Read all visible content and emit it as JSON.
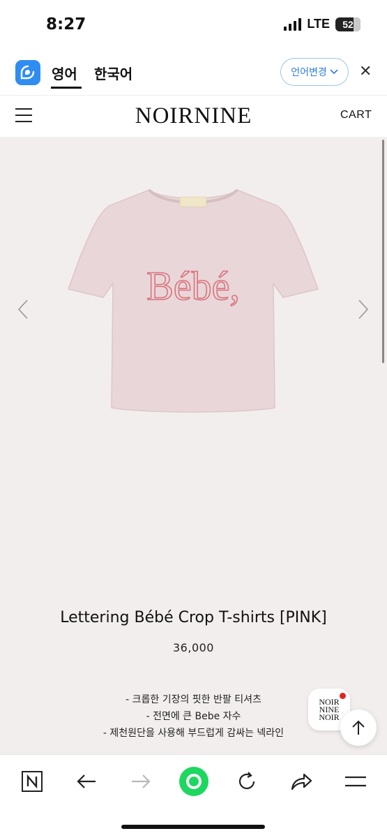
{
  "status_bar": {
    "time": "8:27",
    "network": "LTE",
    "battery": "52"
  },
  "translate_bar": {
    "tab_active": "영어",
    "tab_second": "한국어",
    "language_change_label": "언어변경",
    "close_symbol": "✕"
  },
  "site_header": {
    "logo": "NOIRNINE",
    "cart_label": "CART"
  },
  "product": {
    "shirt_print": "Bébé,",
    "title": "Lettering Bébé Crop T-shirts [PINK]",
    "price": "36,000",
    "description": [
      "- 크롭한 기장의 핏한 반팔 티셔츠",
      "- 전면에 큰 Bebe 자수",
      "- 제천원단을 사용해 부드럽게 감싸는 넥라인"
    ]
  },
  "brand_badge": {
    "lines": [
      "NOIR",
      "NINE",
      "NOIR"
    ]
  },
  "colors": {
    "accent_blue": "#2f8df2",
    "product_bg": "#f3eeee",
    "shirt_pink": "#e9d6d8",
    "embroidery": "#d9737e",
    "toolbar_green": "#1ed760"
  },
  "icons": {
    "translate_logo": "translate-app-icon",
    "hamburger": "hamburger-menu-icon",
    "prev": "chevron-left-icon",
    "next": "chevron-right-icon",
    "scroll_top": "arrow-up-icon",
    "toolbar": [
      "naver-n-icon",
      "back-arrow-icon",
      "forward-arrow-icon",
      "green-dot-icon",
      "reload-icon",
      "share-icon",
      "menu-icon"
    ]
  }
}
